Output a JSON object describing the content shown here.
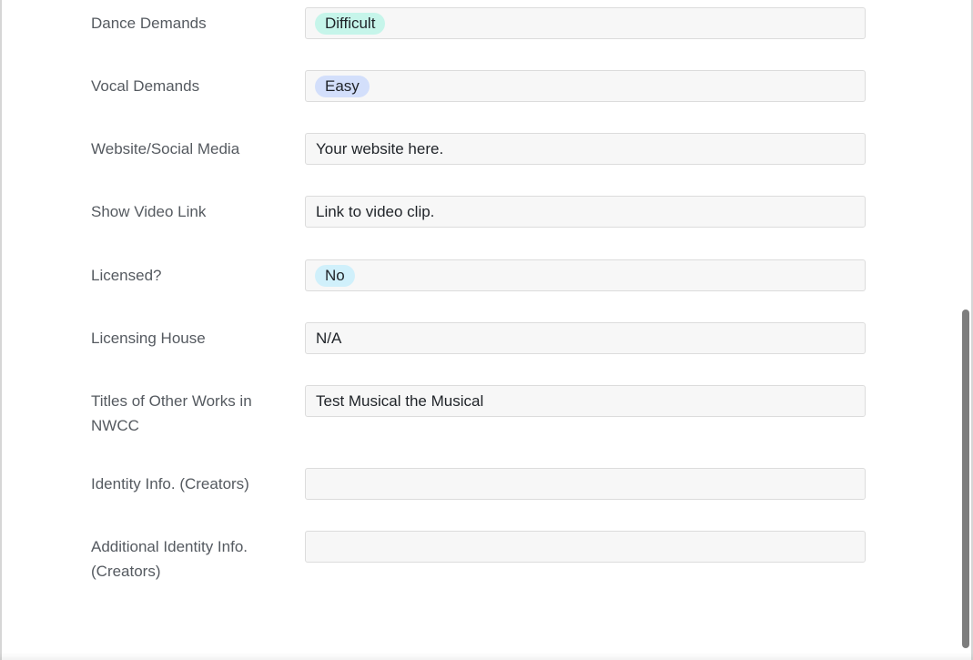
{
  "colors": {
    "tag_difficult": "#c6f5ea",
    "tag_easy": "#d3dffb",
    "tag_no": "#d0f0fb",
    "label_text": "#555a60",
    "field_bg": "#f7f7f7"
  },
  "fields": {
    "dance_demands": {
      "label": "Dance Demands",
      "tag": "Difficult"
    },
    "vocal_demands": {
      "label": "Vocal Demands",
      "tag": "Easy"
    },
    "website": {
      "label": "Website/Social Media",
      "value": "Your website here."
    },
    "video_link": {
      "label": "Show Video Link",
      "value": "Link to video clip."
    },
    "licensed": {
      "label": "Licensed?",
      "tag": "No"
    },
    "licensing_house": {
      "label": "Licensing House",
      "value": "N/A"
    },
    "other_works": {
      "label": "Titles of Other Works in NWCC",
      "value": "Test Musical the Musical"
    },
    "identity_info": {
      "label": "Identity Info. (Creators)",
      "value": ""
    },
    "additional_identity": {
      "label": "Additional Identity Info. (Creators)",
      "value": ""
    }
  }
}
